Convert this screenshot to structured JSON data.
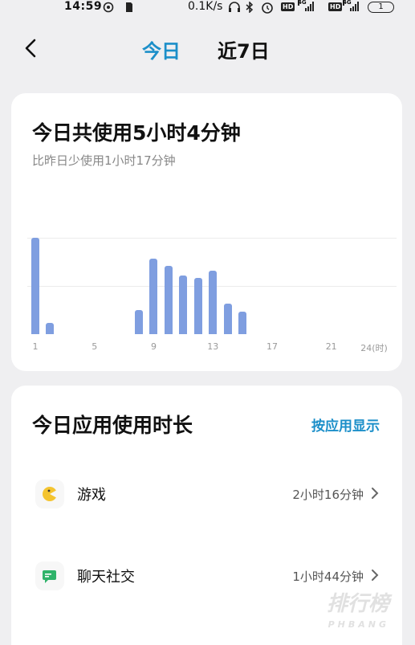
{
  "status_bar": {
    "time": "14:59",
    "net_speed": "0.1K/s",
    "battery": "1",
    "hd1": "HD",
    "hd2": "HD",
    "net1": "4G",
    "net2": "4G"
  },
  "nav": {
    "tabs": [
      {
        "label": "今日",
        "active": true
      },
      {
        "label": "近7日",
        "active": false
      }
    ]
  },
  "summary": {
    "title": "今日共使用5小时4分钟",
    "compare": "比昨日少使用1小时17分钟"
  },
  "chart_data": {
    "type": "bar",
    "x": [
      1,
      2,
      8,
      9,
      10,
      11,
      12,
      13,
      14,
      15
    ],
    "values": [
      100,
      12,
      25,
      78,
      71,
      61,
      58,
      66,
      32,
      23
    ],
    "y_unit_note": "",
    "xlim": [
      1,
      24
    ],
    "ylim": [
      0,
      100
    ],
    "x_tick_labels": [
      "1",
      "5",
      "9",
      "13",
      "17",
      "21",
      "24(时)"
    ],
    "x_tick_values": [
      1,
      5,
      9,
      13,
      17,
      21,
      24
    ],
    "grid": true,
    "bar_color": "#7f9ee0"
  },
  "usage": {
    "title": "今日应用使用时长",
    "toggle_label": "按应用显示",
    "items": [
      {
        "name": "游戏",
        "duration": "2小时16分钟",
        "icon": "game-icon"
      },
      {
        "name": "聊天社交",
        "duration": "1小时44分钟",
        "icon": "chat-icon"
      }
    ]
  },
  "watermark": {
    "text": "排行榜",
    "sub": "PHBANG"
  },
  "colors": {
    "accent": "#1c8fc9",
    "bar": "#7f9ee0",
    "background": "#efeff1"
  }
}
